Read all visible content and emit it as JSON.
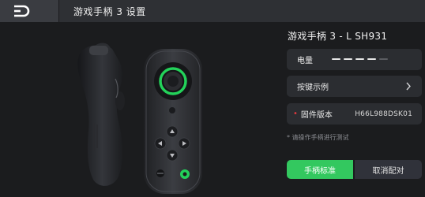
{
  "window": {
    "title": "游戏手柄 3 设置"
  },
  "device": {
    "name": "游戏手柄 3 - L SH931"
  },
  "battery": {
    "label": "电量",
    "level_segments": 4,
    "total_segments": 5
  },
  "key_example": {
    "label": "按键示例"
  },
  "firmware": {
    "label": "固件版本",
    "required_mark": "•",
    "value": "H66L988DSK01"
  },
  "hint": "* 请操作手柄进行测试",
  "buttons": {
    "calibrate": "手柄标准",
    "unpair": "取消配对"
  },
  "colors": {
    "accent": "#33c85f",
    "ring": "#23d25a",
    "warn": "#e0393e"
  }
}
